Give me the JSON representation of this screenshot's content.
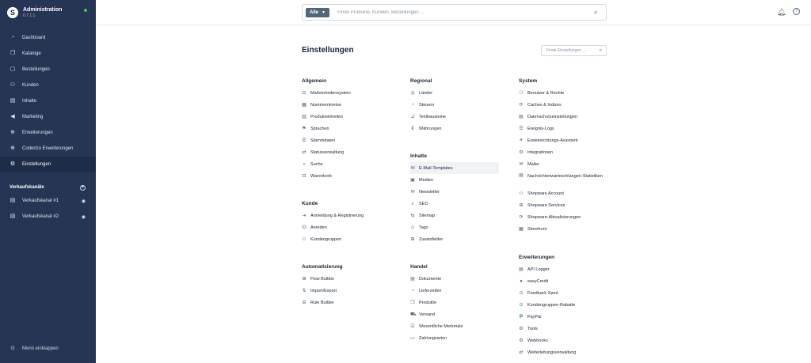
{
  "app": {
    "title": "Administration",
    "version": "6.7.1.1"
  },
  "sidebar": {
    "items": [
      {
        "label": "Dashboard",
        "icon": "◔"
      },
      {
        "label": "Kataloge",
        "icon": "❐"
      },
      {
        "label": "Bestellungen",
        "icon": "▢"
      },
      {
        "label": "Kunden",
        "icon": "⚇"
      },
      {
        "label": "Inhalte",
        "icon": "▤"
      },
      {
        "label": "Marketing",
        "icon": "◀"
      },
      {
        "label": "Erweiterungen",
        "icon": "⊕"
      },
      {
        "label": "Coderizo Erweiterungen",
        "icon": "⊕"
      },
      {
        "label": "Einstellungen",
        "icon": "⚙"
      }
    ],
    "sales_channels": {
      "title": "Verkaufskanäle",
      "items": [
        {
          "label": "Verkaufskanal #1"
        },
        {
          "label": "Verkaufskanal #2"
        }
      ]
    },
    "collapse_label": "Menü einklappen"
  },
  "topbar": {
    "search_type": "Alle",
    "search_placeholder": "Finde Produkte, Kunden, Bestellungen ..."
  },
  "page": {
    "title": "Einstellungen",
    "search_placeholder": "Finde Einstellungen ..."
  },
  "groups": {
    "allgemein": {
      "title": "Allgemein",
      "items": [
        {
          "label": "Maßeinheitensystem",
          "icon": "⚖"
        },
        {
          "label": "Nummernkreise",
          "icon": "▦"
        },
        {
          "label": "Produkteinheiten",
          "icon": "▥"
        },
        {
          "label": "Sprachen",
          "icon": "⚑"
        },
        {
          "label": "Stammdaten",
          "icon": "☰"
        },
        {
          "label": "Statusverwaltung",
          "icon": "⇄"
        },
        {
          "label": "Suche",
          "icon": "⌕"
        },
        {
          "label": "Warenkorb",
          "icon": "⊡"
        }
      ]
    },
    "kunde": {
      "title": "Kunde",
      "items": [
        {
          "label": "Anmeldung & Registrierung",
          "icon": "⇥"
        },
        {
          "label": "Anreden",
          "icon": "☊"
        },
        {
          "label": "Kundengruppen",
          "icon": "⚇"
        }
      ]
    },
    "automatisierung": {
      "title": "Automatisierung",
      "items": [
        {
          "label": "Flow Builder",
          "icon": "⊞"
        },
        {
          "label": "Import/Export",
          "icon": "⇅"
        },
        {
          "label": "Rule Builder",
          "icon": "⊟"
        }
      ]
    },
    "regional": {
      "title": "Regional",
      "items": [
        {
          "label": "Länder",
          "icon": "◎"
        },
        {
          "label": "Steuern",
          "icon": "◔"
        },
        {
          "label": "Textbausteine",
          "icon": "⊿"
        },
        {
          "label": "Währungen",
          "icon": "€"
        }
      ]
    },
    "inhalte": {
      "title": "Inhalte",
      "items": [
        {
          "label": "E-Mail-Templates",
          "icon": "✉"
        },
        {
          "label": "Medien",
          "icon": "▣"
        },
        {
          "label": "Newsletter",
          "icon": "✉"
        },
        {
          "label": "SEO",
          "icon": "⌕"
        },
        {
          "label": "Sitemap",
          "icon": "⇆"
        },
        {
          "label": "Tags",
          "icon": "◇"
        },
        {
          "label": "Zusatzfelder",
          "icon": "⊞"
        }
      ]
    },
    "handel": {
      "title": "Handel",
      "items": [
        {
          "label": "Dokumente",
          "icon": "▤"
        },
        {
          "label": "Lieferzeiten",
          "icon": "◔"
        },
        {
          "label": "Produkte",
          "icon": "❐"
        },
        {
          "label": "Versand",
          "icon": "⛟"
        },
        {
          "label": "Wesentliche Merkmale",
          "icon": "☑"
        },
        {
          "label": "Zahlungsarten",
          "icon": "▭"
        }
      ]
    },
    "system": {
      "title": "System",
      "items": [
        {
          "label": "Benutzer & Rechte",
          "icon": "⚇"
        },
        {
          "label": "Caches & Indizes",
          "icon": "⟳"
        },
        {
          "label": "Datenschutzeinstellungen",
          "icon": "▤"
        },
        {
          "label": "Ereignis-Logs",
          "icon": "☰"
        },
        {
          "label": "Ersteinrichtungs-Assistent",
          "icon": "✈"
        },
        {
          "label": "Integrationen",
          "icon": "⚙"
        },
        {
          "label": "Mailer",
          "icon": "✉"
        },
        {
          "label": "Nachrichtenwarteschlangen-Statistiken",
          "icon": "▤"
        },
        {
          "label": "Shopware Account",
          "icon": "⚇"
        },
        {
          "label": "Shopware Services",
          "icon": "⊞"
        },
        {
          "label": "Shopware-Aktualisierungen",
          "icon": "⟳"
        },
        {
          "label": "Storefront",
          "icon": "▦"
        }
      ]
    },
    "erweiterungen": {
      "title": "Erweiterungen",
      "items": [
        {
          "label": "API Logger",
          "icon": "▤"
        },
        {
          "label": "easyCredit",
          "icon": "●"
        },
        {
          "label": "Feedback Xpert",
          "icon": "⊙"
        },
        {
          "label": "Kundengruppen-Rabatte",
          "icon": "⊙"
        },
        {
          "label": "PayPal",
          "icon": "P"
        },
        {
          "label": "Tools",
          "icon": "⚙"
        },
        {
          "label": "Webhooks",
          "icon": "⚙"
        },
        {
          "label": "Weiterleitungsverwaltung",
          "icon": "⇄"
        }
      ]
    }
  }
}
